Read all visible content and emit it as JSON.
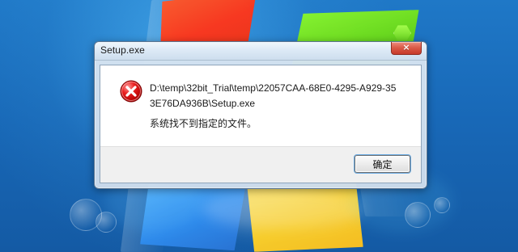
{
  "dialog": {
    "title": "Setup.exe",
    "close_symbol": "×",
    "message_path": "D:\\temp\\32bit_Trial\\temp\\22057CAA-68E0-4295-A929-353E76DA936B\\Setup.exe",
    "message_text": "系统找不到指定的文件。",
    "ok_label": "确定",
    "icon": "error-icon"
  },
  "desktop": {
    "wallpaper": "windows-7-default",
    "colors": {
      "sky": "#1b6fc0",
      "red_flag": "#ff3519",
      "green_flag": "#6bda18",
      "blue_flag": "#2f8df0",
      "yellow_flag": "#ffd126"
    },
    "gadget_icon": "gadget-icon"
  }
}
